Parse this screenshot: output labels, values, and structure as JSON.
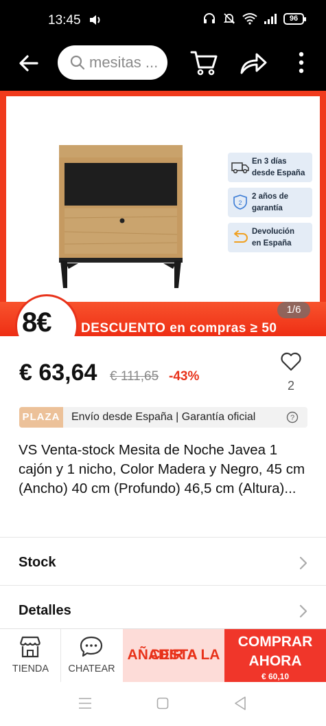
{
  "status": {
    "time": "13:45",
    "battery": "96"
  },
  "search": {
    "placeholder": "mesitas ..."
  },
  "gallery": {
    "counter": "1/6",
    "badges": [
      {
        "line1": "En 3 días",
        "line2": "desde España",
        "icon": "truck-icon"
      },
      {
        "line1": "2 años de",
        "line2": "garantía",
        "icon": "shield-icon"
      },
      {
        "line1": "Devolución",
        "line2": "en España",
        "icon": "return-icon"
      }
    ],
    "promo_amount": "8€",
    "promo_text": "DESCUENTO en compras ≥ 50"
  },
  "price": {
    "current": "€ 63,64",
    "original": "€ 111,65",
    "discount": "-43%",
    "wishlist_count": "2"
  },
  "plaza": {
    "tag": "PLAZA",
    "text": "Envío desde España | Garantía oficial"
  },
  "product": {
    "title": "VS Venta-stock Mesita de Noche Javea 1 cajón y 1 nicho, Color Madera y Negro, 45 cm (Ancho) 40 cm (Profundo) 46,5 cm (Altura)..."
  },
  "sections": {
    "stock": "Stock",
    "details": "Detalles"
  },
  "actions": {
    "store": "TIENDA",
    "chat": "CHATEAR",
    "add_line1": "AÑADIR A LA",
    "add_line2": "CESTA",
    "buy_line1": "COMPRAR",
    "buy_line2": "AHORA",
    "buy_price": "€ 60,10"
  },
  "colors": {
    "accent": "#f0362a",
    "plaza": "#ecc199"
  }
}
